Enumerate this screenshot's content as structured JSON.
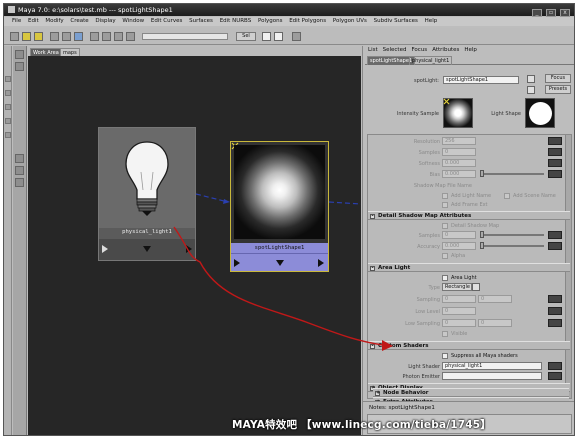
{
  "window": {
    "title": "Maya 7.0: e:\\solars\\test.mb  ---  spotLightShape1",
    "min_label": "_",
    "max_label": "▫",
    "close_label": "x"
  },
  "menubar": [
    "File",
    "Edit",
    "Modify",
    "Create",
    "Display",
    "Window",
    "Edit Curves",
    "Surfaces",
    "Edit NURBS",
    "Polygons",
    "Edit Polygons",
    "Polygon UVs",
    "Subdiv Surfaces",
    "Help"
  ],
  "toolbar": {
    "field_label": "Sel"
  },
  "hypershade": {
    "tabs": [
      "Work Area",
      "maps"
    ],
    "nodes": {
      "physical_light": {
        "label": "physical_light1"
      },
      "spotlight": {
        "label": "spotLightShape1"
      }
    }
  },
  "attribute_editor": {
    "menu": [
      "List",
      "Selected",
      "Focus",
      "Attributes",
      "Help"
    ],
    "tabs": [
      "spotLightShape1",
      "physical_light1"
    ],
    "header": {
      "node_label": "spotLight:",
      "node_value": "spotLightShape1",
      "focus_button": "Focus",
      "presets_button": "Presets",
      "intensity_sample_label": "Intensity Sample",
      "light_shape_label": "Light Shape"
    },
    "shadows": {
      "resolution_label": "Resolution",
      "resolution_value": "256",
      "samples_label": "Samples",
      "samples_value": "0",
      "softness_label": "Softness",
      "softness_value": "0.000",
      "bias_label": "Bias",
      "bias_value": "0.000",
      "file_name_label": "Shadow Map File Name",
      "add_light_name": "Add Light Name",
      "add_scene_name": "Add Scene Name",
      "add_frame_ext": "Add Frame Ext"
    },
    "detail_shadow": {
      "title": "Detail Shadow Map Attributes",
      "detail_shadow_map": "Detail Shadow Map",
      "samples_label": "Samples",
      "samples_value": "0",
      "accuracy_label": "Accuracy",
      "accuracy_value": "0.000",
      "alpha": "Alpha"
    },
    "area_light": {
      "title": "Area Light",
      "area_light_chk": "Area Light",
      "type_label": "Type",
      "type_value": "Rectangle",
      "sampling_label": "Sampling",
      "sampling_v1": "0",
      "sampling_v2": "0",
      "low_level_label": "Low Level",
      "low_level_value": "0",
      "low_sampling_label": "Low Sampling",
      "low_sampling_v1": "0",
      "low_sampling_v2": "0",
      "visible": "Visible"
    },
    "custom_shaders": {
      "title": "Custom Shaders",
      "suppress": "Suppress all Maya shaders",
      "light_shader_label": "Light Shader",
      "light_shader_value": "physical_light1",
      "photon_emitter_label": "Photon Emitter"
    },
    "collapsed_sections": [
      "Object Display",
      "Node Behavior",
      "Extra Attributes"
    ],
    "notes_label": "Notes: spotLightShape1"
  },
  "watermark": "MAYA特效吧 【www.linecg.com/tieba/1745】",
  "colors": {
    "viewport_bg": "#262626",
    "spotlight_label_bg": "#8c8cd8",
    "connection_arrow": "#c01818",
    "node_link": "#2a3fb0"
  }
}
